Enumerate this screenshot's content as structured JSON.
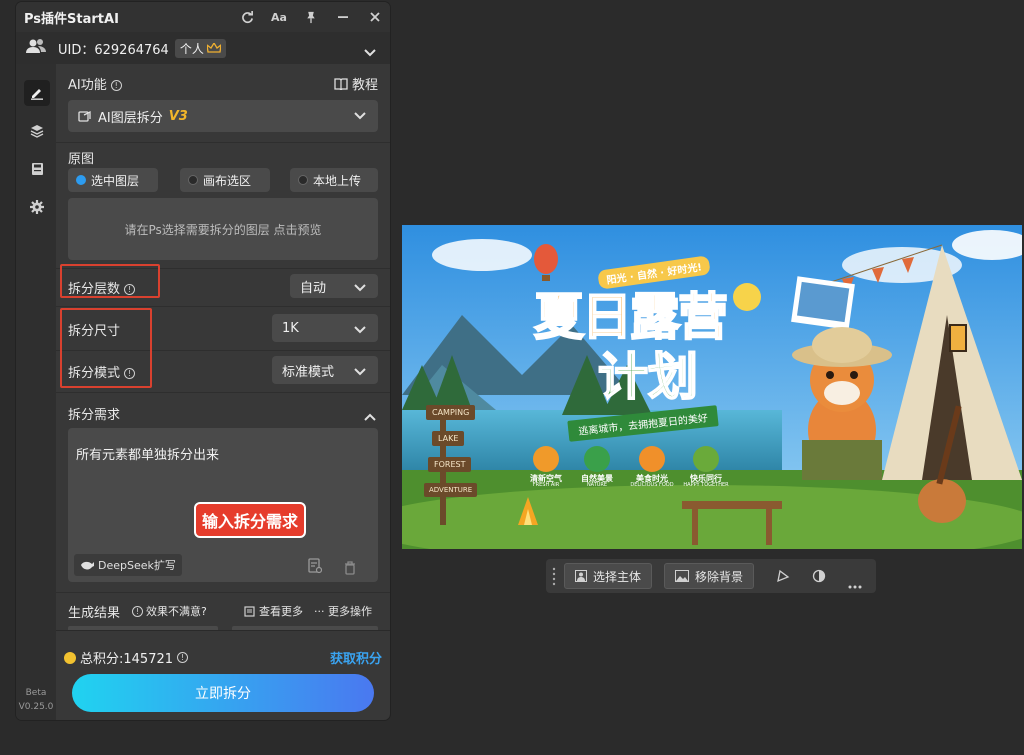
{
  "panel": {
    "title": "Ps插件StartAI",
    "uid": "UID：629264764",
    "tier": "个人",
    "version_beta": "Beta",
    "version": "V0.25.0"
  },
  "ai_function": {
    "label": "AI功能",
    "tutorial": "教程",
    "selected": "AI图层拆分",
    "selected_version": "V3"
  },
  "source": {
    "label": "原图",
    "options": [
      "选中图层",
      "画布选区",
      "本地上传"
    ],
    "selected_index": 0,
    "preview_hint": "请在Ps选择需要拆分的图层 点击预览"
  },
  "settings": {
    "layers_label": "拆分层数",
    "layers_value": "自动",
    "size_label": "拆分尺寸",
    "size_value": "1K",
    "mode_label": "拆分模式",
    "mode_value": "标准模式"
  },
  "requirement": {
    "label": "拆分需求",
    "text": "所有元素都单独拆分出来",
    "callout": "输入拆分需求",
    "deepseek": "DeepSeek扩写"
  },
  "results": {
    "label": "生成结果",
    "unsatisfied": "效果不满意?",
    "view_more": "查看更多",
    "more_actions": "··· 更多操作"
  },
  "points": {
    "label": "总积分:145721",
    "get": "获取积分"
  },
  "primary_button": "立即拆分",
  "poster": {
    "tagline": "阳光 · 自然 · 好时光!",
    "title_line1": "夏日露营",
    "title_line2": "计划",
    "banner": "逃离城市，去拥抱夏日的美好",
    "features": [
      {
        "cn": "清新空气",
        "en": "FRESH AIR"
      },
      {
        "cn": "自然美景",
        "en": "NATURE"
      },
      {
        "cn": "美食时光",
        "en": "DELICIOUS FOOD"
      },
      {
        "cn": "快乐同行",
        "en": "HAPPY TOGETHER"
      }
    ],
    "signs": [
      "CAMPING",
      "LAKE",
      "FOREST",
      "ADVENTURE"
    ]
  },
  "toolbar": {
    "select_subject": "选择主体",
    "remove_bg": "移除背景"
  },
  "colors": {
    "accent_blue": "#2d9cf0",
    "highlight_red": "#d9412f",
    "button_gradient_start": "#20d3f0",
    "button_gradient_end": "#4a78f0",
    "coin": "#f2c230"
  }
}
